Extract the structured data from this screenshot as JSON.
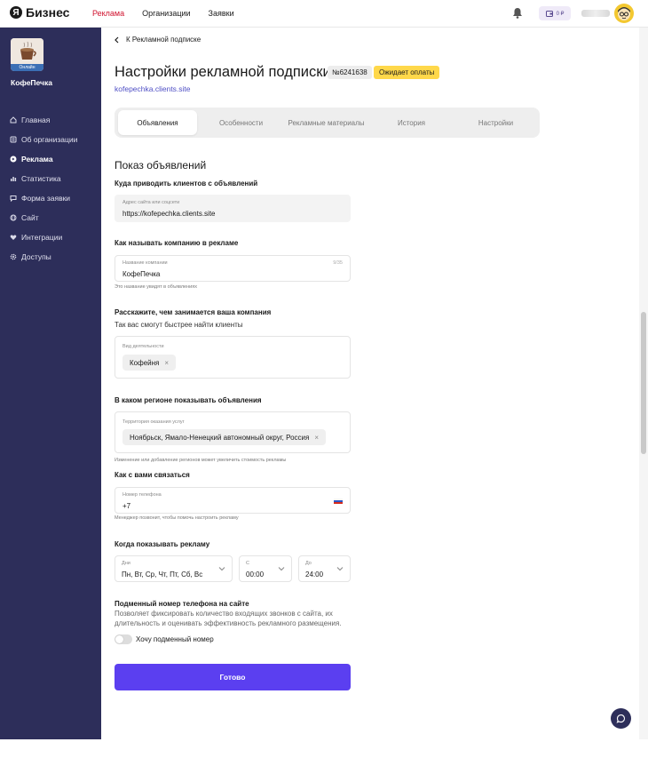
{
  "topbar": {
    "logo_letter": "Я",
    "logo_text": "Бизнес",
    "nav": [
      {
        "label": "Реклама",
        "active": true
      },
      {
        "label": "Организации",
        "active": false
      },
      {
        "label": "Заявки",
        "active": false
      }
    ],
    "wallet_label": "0 ₽",
    "accent_color": "#d0122e"
  },
  "sidebar": {
    "business_name": "КофеПечка",
    "logo_badge": "Онлайн",
    "items": [
      {
        "label": "Главная",
        "icon": "home-icon",
        "active": false
      },
      {
        "label": "Об организации",
        "icon": "info-icon",
        "active": false
      },
      {
        "label": "Реклама",
        "icon": "ads-icon",
        "active": true
      },
      {
        "label": "Статистика",
        "icon": "stats-icon",
        "active": false
      },
      {
        "label": "Форма заявки",
        "icon": "form-icon",
        "active": false
      },
      {
        "label": "Сайт",
        "icon": "globe-icon",
        "active": false
      },
      {
        "label": "Интеграции",
        "icon": "heart-icon",
        "active": false
      },
      {
        "label": "Доступы",
        "icon": "gear-icon",
        "active": false
      }
    ],
    "bg_color": "#2d2e5a"
  },
  "page": {
    "back_label": "К Рекламной подписке",
    "title": "Настройки рекламной подписки",
    "subscription_number": "№6241638",
    "status": "Ожидает оплаты",
    "site_link": "kofepechka.clients.site",
    "tabs": [
      {
        "label": "Объявления",
        "active": true
      },
      {
        "label": "Особенности",
        "active": false
      },
      {
        "label": "Рекламные материалы",
        "active": false
      },
      {
        "label": "История",
        "active": false
      },
      {
        "label": "Настройки",
        "active": false
      }
    ]
  },
  "form": {
    "section_title": "Показ объявлений",
    "site": {
      "question": "Куда приводить клиентов с объявлений",
      "label": "Адрес сайта или соцсети",
      "value": "https://kofepechka.clients.site"
    },
    "company": {
      "question": "Как называть компанию в рекламе",
      "label": "Название компании",
      "counter": "9/35",
      "value": "КофеПечка",
      "hint": "Это название увидят в объявлениях"
    },
    "activity": {
      "question": "Расскажите, чем занимается ваша компания",
      "subtitle": "Так вас смогут быстрее найти клиенты",
      "label": "Вид деятельности",
      "chip": "Кофейня"
    },
    "region": {
      "question": "В каком регионе показывать объявления",
      "label": "Территория оказания услуг",
      "chip": "Ноябрьск, Ямало-Ненецкий автономный округ, Россия",
      "hint": "Изменение или добавление регионов может увеличить стоимость рекламы"
    },
    "contact": {
      "question": "Как с вами связаться",
      "label": "Номер телефона",
      "value": "+7",
      "hint": "Менеджер позвонит, чтобы помочь настроить рекламу"
    },
    "schedule": {
      "question": "Когда показывать рекламу",
      "days_label": "Дни",
      "days_value": "Пн, Вт, Ср, Чт, Пт, Сб, Вс",
      "from_label": "С",
      "from_value": "00:00",
      "to_label": "До",
      "to_value": "24:00"
    },
    "substitute": {
      "question": "Подменный номер телефона на сайте",
      "description_1": "Позволяет фиксировать количество входящих звонков с сайта, их",
      "description_2": "длительность и оценивать эффективность рекламного размещения.",
      "toggle_label": "Хочу подменный номер",
      "toggle_on": false
    },
    "submit_label": "Готово",
    "submit_color": "#5b3ff0"
  }
}
